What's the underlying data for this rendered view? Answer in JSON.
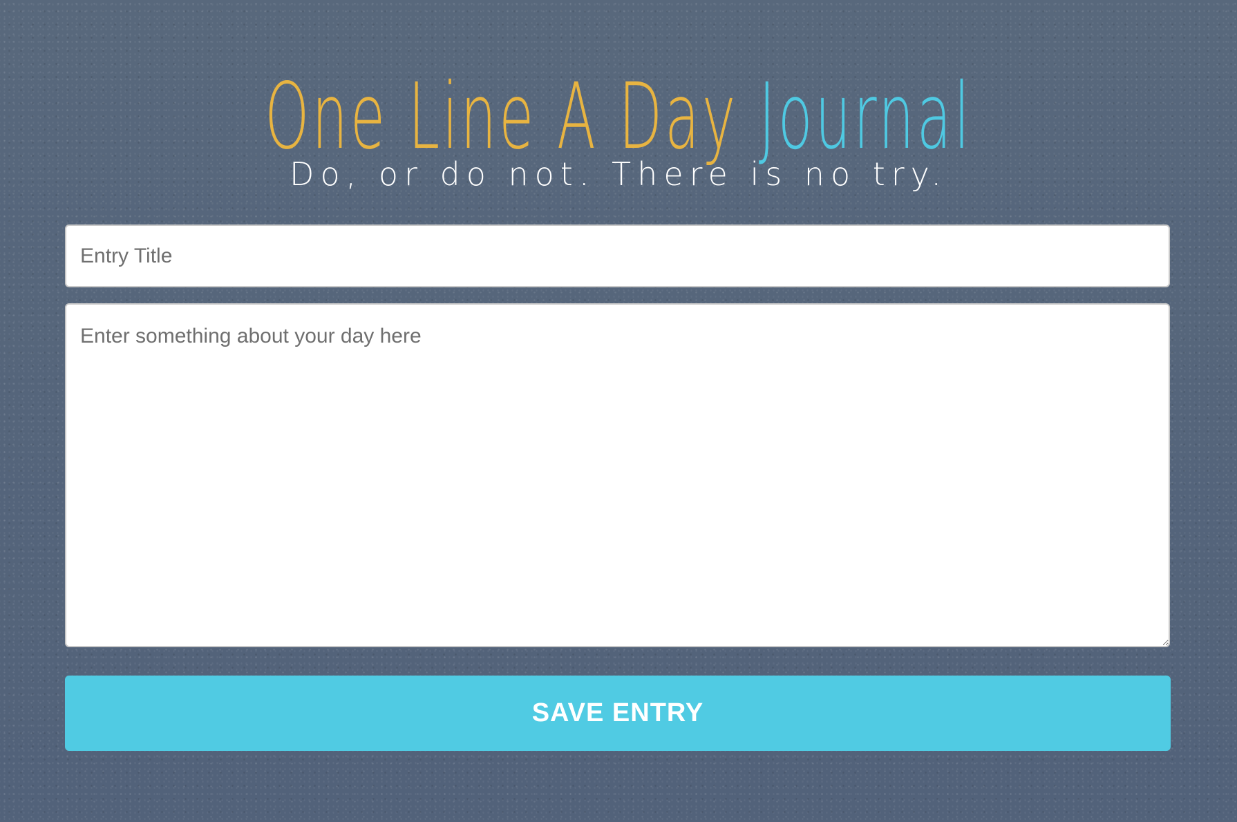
{
  "header": {
    "title_part_a": "One Line A Day",
    "title_part_b": "Journal",
    "tagline": "Do, or do not. There is no try."
  },
  "form": {
    "title_placeholder": "Entry Title",
    "title_value": "",
    "body_placeholder": "Enter something about your day here",
    "body_value": "",
    "save_label": "SAVE ENTRY"
  },
  "colors": {
    "background": "#56667a",
    "title_accent_yellow": "#e8b441",
    "title_accent_blue": "#4fc9e2",
    "button": "#50cbe3"
  }
}
